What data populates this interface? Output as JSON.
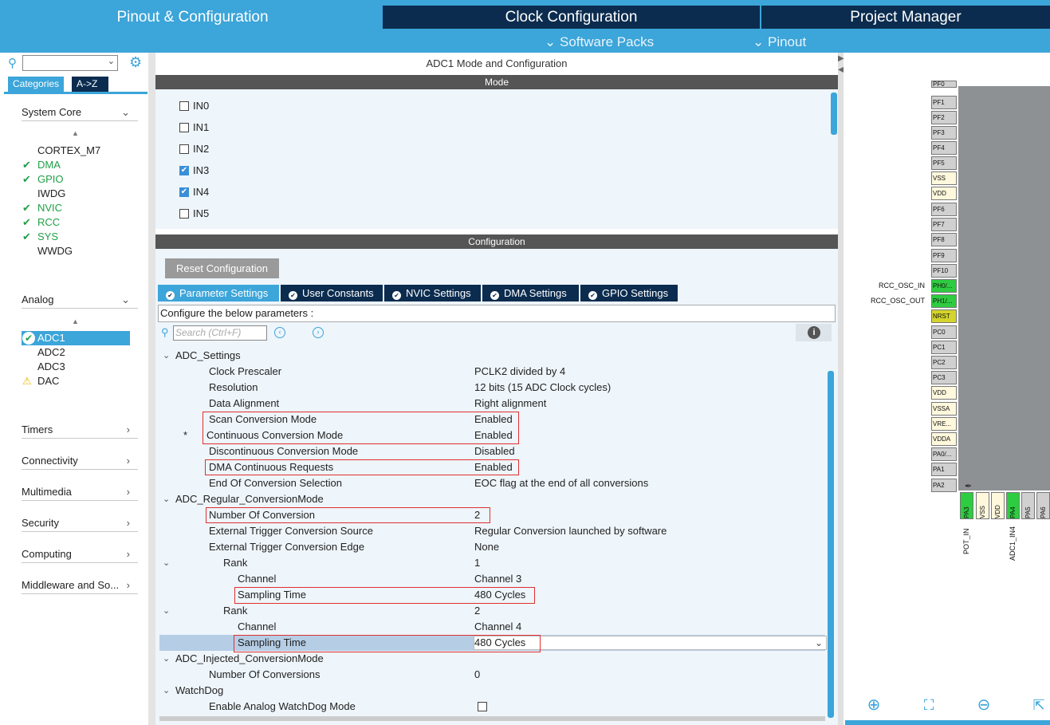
{
  "tabs": {
    "pinout_config": "Pinout & Configuration",
    "clock_config": "Clock Configuration",
    "project_manager": "Project Manager",
    "software_packs": "Software Packs",
    "pinout": "Pinout"
  },
  "left": {
    "cat_tab_categories": "Categories",
    "cat_tab_az": "A->Z",
    "sections": {
      "system_core": "System Core",
      "analog": "Analog",
      "timers": "Timers",
      "connectivity": "Connectivity",
      "multimedia": "Multimedia",
      "security": "Security",
      "computing": "Computing",
      "middleware": "Middleware and So..."
    },
    "system_core_items": [
      "CORTEX_M7",
      "DMA",
      "GPIO",
      "IWDG",
      "NVIC",
      "RCC",
      "SYS",
      "WWDG"
    ],
    "analog_items": [
      "ADC1",
      "ADC2",
      "ADC3",
      "DAC"
    ]
  },
  "middle": {
    "title": "ADC1 Mode and Configuration",
    "mode_header": "Mode",
    "config_header": "Configuration",
    "mode_inputs": [
      {
        "label": "IN0",
        "checked": false
      },
      {
        "label": "IN1",
        "checked": false
      },
      {
        "label": "IN2",
        "checked": false
      },
      {
        "label": "IN3",
        "checked": true
      },
      {
        "label": "IN4",
        "checked": true
      },
      {
        "label": "IN5",
        "checked": false
      }
    ],
    "reset_button": "Reset Configuration",
    "param_tabs": [
      "Parameter Settings",
      "User Constants",
      "NVIC Settings",
      "DMA Settings",
      "GPIO Settings"
    ],
    "configure_text": "Configure the below parameters :",
    "search_placeholder": "Search (Ctrl+F)",
    "info_icon": "i",
    "params": {
      "adc_settings": "ADC_Settings",
      "clock_prescaler": "Clock Prescaler",
      "clock_prescaler_val": "PCLK2 divided by 4",
      "resolution": "Resolution",
      "resolution_val": "12 bits (15 ADC Clock cycles)",
      "data_alignment": "Data Alignment",
      "data_alignment_val": "Right alignment",
      "scan_mode": "Scan Conversion Mode",
      "scan_mode_val": "Enabled",
      "continuous_mode": "Continuous Conversion Mode",
      "continuous_mode_val": "Enabled",
      "continuous_marker": "*",
      "discontinuous_mode": "Discontinuous Conversion Mode",
      "discontinuous_mode_val": "Disabled",
      "dma_requests": "DMA Continuous Requests",
      "dma_requests_val": "Enabled",
      "eoc_selection": "End Of Conversion Selection",
      "eoc_selection_val": "EOC flag at the end of all conversions",
      "regular_mode": "ADC_Regular_ConversionMode",
      "num_conversion": "Number Of Conversion",
      "num_conversion_val": "2",
      "ext_trigger_source": "External Trigger Conversion Source",
      "ext_trigger_source_val": "Regular Conversion launched by software",
      "ext_trigger_edge": "External Trigger Conversion Edge",
      "ext_trigger_edge_val": "None",
      "rank": "Rank",
      "rank1_val": "1",
      "channel": "Channel",
      "channel1_val": "Channel 3",
      "sampling_time": "Sampling Time",
      "sampling1_val": "480 Cycles",
      "rank2_val": "2",
      "channel2_val": "Channel 4",
      "sampling2_val": "480 Cycles",
      "injected_mode": "ADC_Injected_ConversionMode",
      "num_conversions": "Number Of Conversions",
      "num_conversions_val": "0",
      "watchdog": "WatchDog",
      "enable_watchdog": "Enable Analog WatchDog Mode"
    }
  },
  "pinout": {
    "side_pins": [
      "PF0",
      "PF1",
      "PF2",
      "PF3",
      "PF4",
      "PF5",
      "VSS",
      "VDD",
      "PF6",
      "PF7",
      "PF8",
      "PF9",
      "PF10",
      "PH0/...",
      "PH1/...",
      "NRST",
      "PC0",
      "PC1",
      "PC2",
      "PC3",
      "VDD",
      "VSSA",
      "VRE...",
      "VDDA",
      "PA0/...",
      "PA1",
      "PA2"
    ],
    "side_labels": {
      "ph0": "RCC_OSC_IN",
      "ph1": "RCC_OSC_OUT"
    },
    "bottom_pins": [
      "PA3",
      "VSS",
      "VDD",
      "PA4",
      "PA5",
      "PA6"
    ],
    "bottom_labels": {
      "pa3": "POT_IN",
      "pa4": "ADC1_IN4"
    }
  }
}
